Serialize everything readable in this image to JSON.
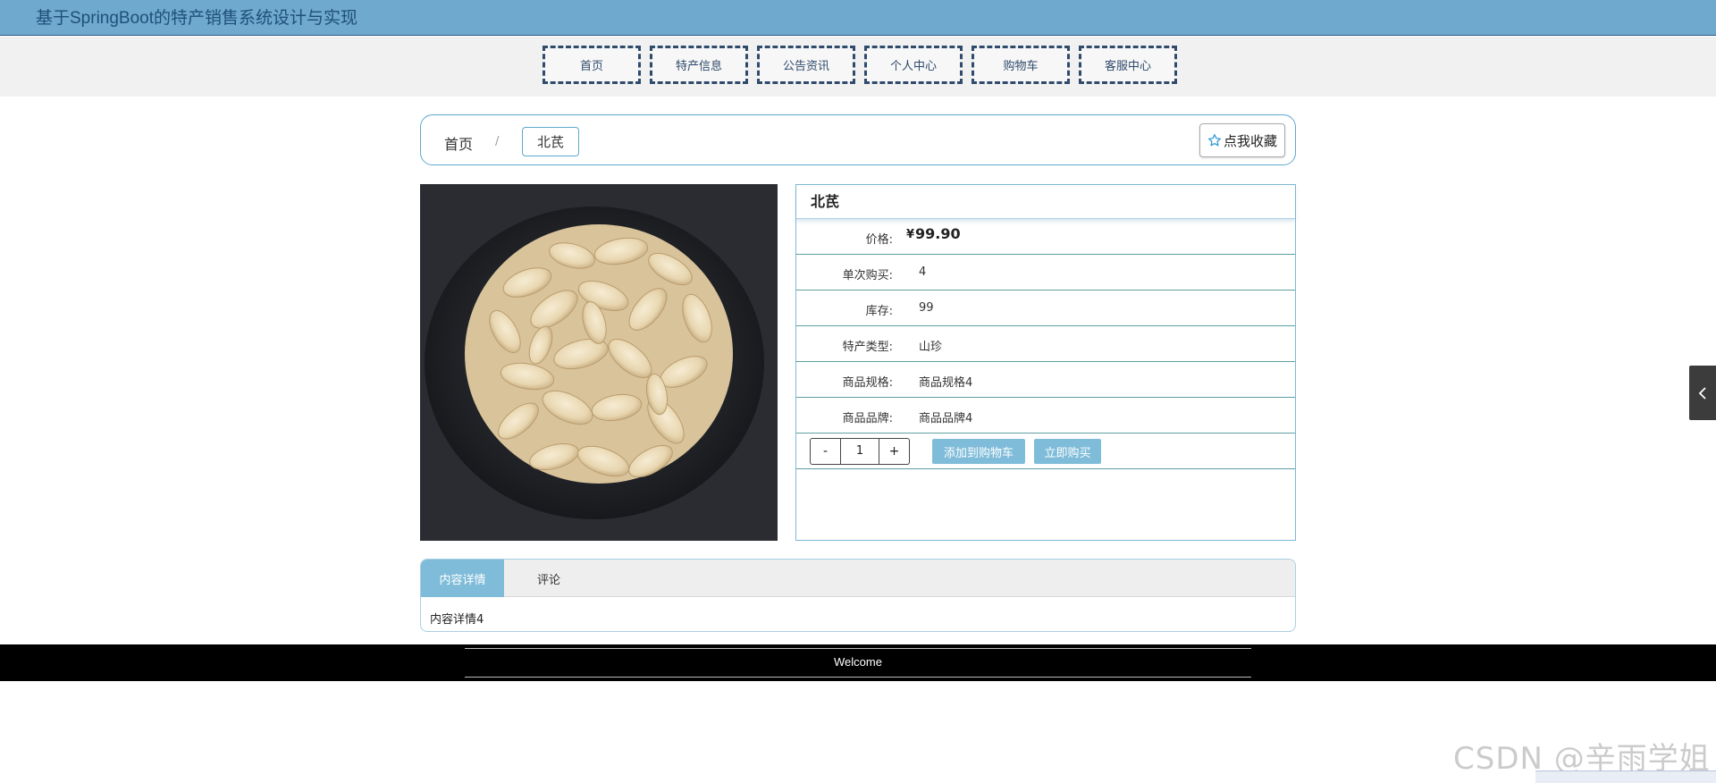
{
  "header": {
    "title": "基于SpringBoot的特产销售系统设计与实现"
  },
  "nav": {
    "items": [
      "首页",
      "特产信息",
      "公告资讯",
      "个人中心",
      "购物车",
      "客服中心"
    ]
  },
  "breadcrumb": {
    "home": "首页",
    "separator": "/",
    "current": "北芪"
  },
  "favorite": {
    "label": "点我收藏",
    "icon": "star-outline-icon"
  },
  "product": {
    "name": "北芪",
    "price_symbol": "¥",
    "price": "99.90",
    "details": [
      {
        "label": "价格:",
        "value": ""
      },
      {
        "label": "单次购买:",
        "value": "4"
      },
      {
        "label": "库存:",
        "value": "99"
      },
      {
        "label": "特产类型:",
        "value": "山珍"
      },
      {
        "label": "商品规格:",
        "value": "商品规格4"
      },
      {
        "label": "商品品牌:",
        "value": "商品品牌4"
      }
    ],
    "quantity": {
      "minus": "-",
      "value": "1",
      "plus": "+"
    },
    "actions": {
      "add_to_cart": "添加到购物车",
      "buy_now": "立即购买"
    }
  },
  "tabs": {
    "items": [
      "内容详情",
      "评论"
    ],
    "active_content": "内容详情4"
  },
  "footer": {
    "welcome": "Welcome"
  },
  "watermark": "CSDN @辛雨学姐",
  "colors": {
    "topbar": "#6fa9cd",
    "accent": "#7fbcd9",
    "nav_border": "#2f4a6b",
    "footer": "#000000"
  }
}
